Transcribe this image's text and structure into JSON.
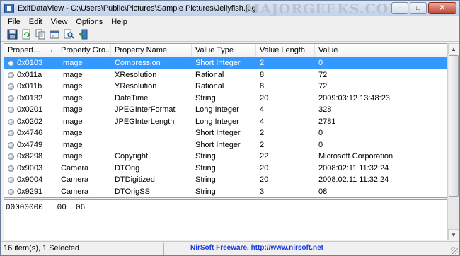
{
  "window": {
    "title": "ExifDataView  -  C:\\Users\\Public\\Pictures\\Sample Pictures\\Jellyfish.jpg",
    "watermark": "MAJORGEEKS.COM",
    "controls": {
      "minimize": "–",
      "maximize": "□",
      "close": "✕"
    }
  },
  "menu": [
    "File",
    "Edit",
    "View",
    "Options",
    "Help"
  ],
  "toolbar": [
    "save-icon",
    "refresh-icon",
    "copy-icon",
    "properties-icon",
    "search-icon",
    "exit-icon"
  ],
  "columns": [
    "Propert...",
    "Property Gro...",
    "Property Name",
    "Value Type",
    "Value Length",
    "Value"
  ],
  "rows": [
    {
      "id": "0x0103",
      "group": "Image",
      "name": "Compression",
      "type": "Short Integer",
      "length": "2",
      "value": "0",
      "selected": true
    },
    {
      "id": "0x011a",
      "group": "Image",
      "name": "XResolution",
      "type": "Rational",
      "length": "8",
      "value": "72"
    },
    {
      "id": "0x011b",
      "group": "Image",
      "name": "YResolution",
      "type": "Rational",
      "length": "8",
      "value": "72"
    },
    {
      "id": "0x0132",
      "group": "Image",
      "name": "DateTime",
      "type": "String",
      "length": "20",
      "value": "2009:03:12 13:48:23"
    },
    {
      "id": "0x0201",
      "group": "Image",
      "name": "JPEGInterFormat",
      "type": "Long Integer",
      "length": "4",
      "value": "328"
    },
    {
      "id": "0x0202",
      "group": "Image",
      "name": "JPEGInterLength",
      "type": "Long Integer",
      "length": "4",
      "value": "2781"
    },
    {
      "id": "0x4746",
      "group": "Image",
      "name": "",
      "type": "Short Integer",
      "length": "2",
      "value": "0"
    },
    {
      "id": "0x4749",
      "group": "Image",
      "name": "",
      "type": "Short Integer",
      "length": "2",
      "value": "0"
    },
    {
      "id": "0x8298",
      "group": "Image",
      "name": "Copyright",
      "type": "String",
      "length": "22",
      "value": "Microsoft Corporation"
    },
    {
      "id": "0x9003",
      "group": "Camera",
      "name": "DTOrig",
      "type": "String",
      "length": "20",
      "value": "2008:02:11 11:32:24"
    },
    {
      "id": "0x9004",
      "group": "Camera",
      "name": "DTDigitized",
      "type": "String",
      "length": "20",
      "value": "2008:02:11 11:32:24"
    },
    {
      "id": "0x9291",
      "group": "Camera",
      "name": "DTOrigSS",
      "type": "String",
      "length": "3",
      "value": "08"
    }
  ],
  "hex": "00000000   00  06",
  "status": {
    "items": "16 item(s), 1 Selected",
    "link": "NirSoft Freeware.  http://www.nirsoft.net"
  },
  "colors": {
    "selection": "#3399ff",
    "link": "#1a3bdd"
  }
}
